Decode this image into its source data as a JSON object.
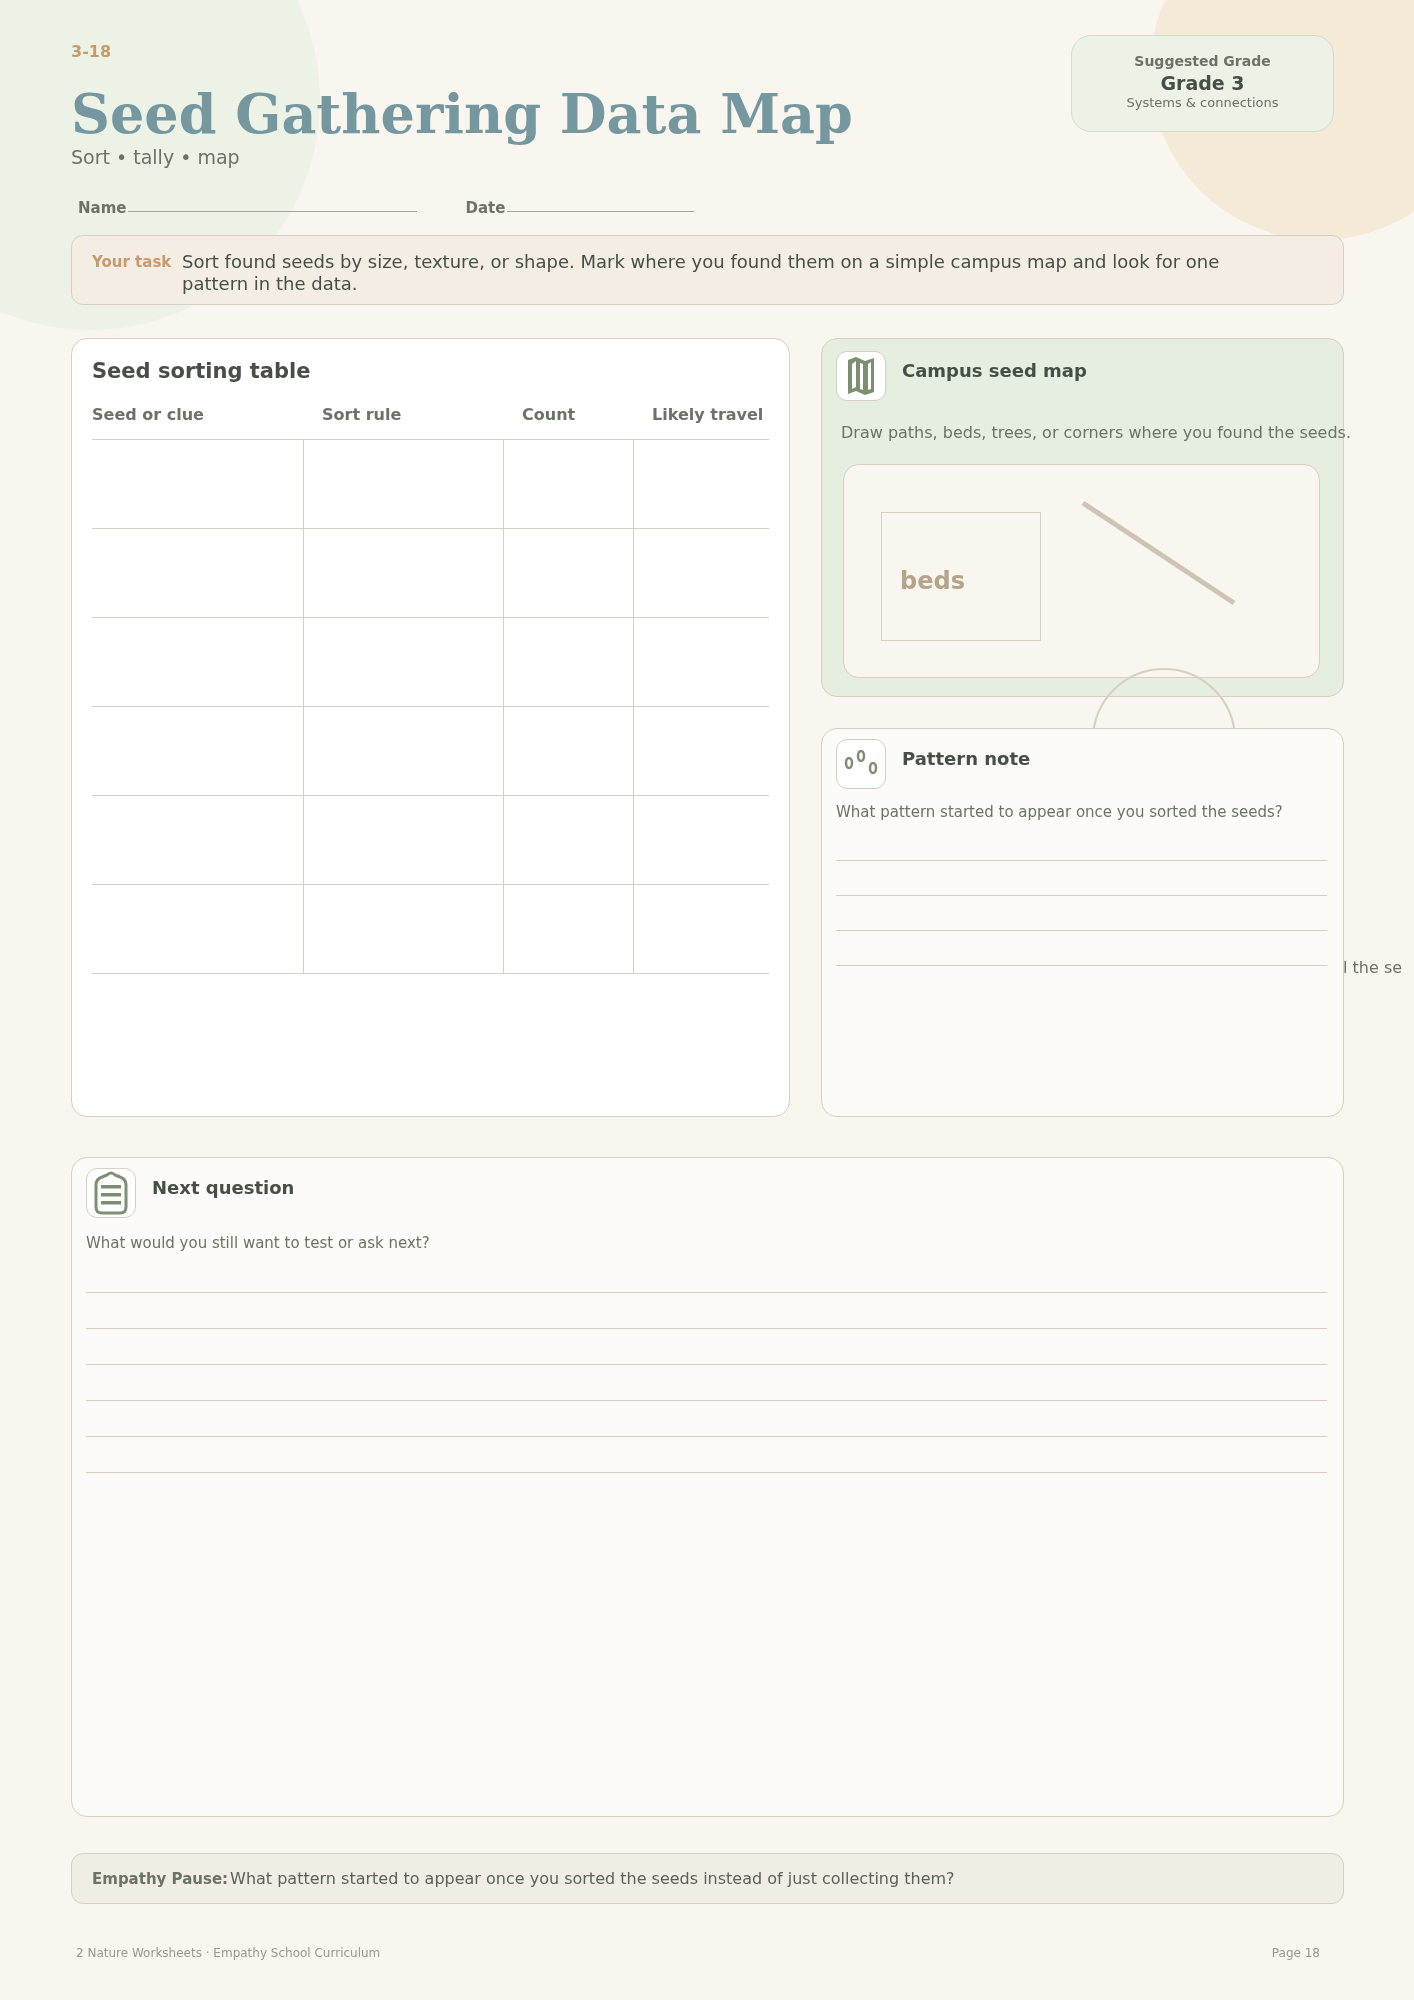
{
  "header": {
    "code": "3-18",
    "title": "Seed Gathering Data Map",
    "subtitle": "Sort • tally • map"
  },
  "grade_card": {
    "label": "Suggested Grade",
    "grade": "Grade 3",
    "strand": "Systems & connections"
  },
  "fields": [
    {
      "label": "Name"
    },
    {
      "label": "Date"
    }
  ],
  "task": {
    "label": "Your task",
    "text": "Sort found seeds by size, texture, or shape. Mark where you found them on a simple campus map and look for one pattern in the data."
  },
  "sorting_table": {
    "title": "Seed sorting table",
    "columns": [
      "Seed or clue",
      "Sort rule",
      "Count",
      "Likely travel"
    ]
  },
  "map_card": {
    "title": "Campus seed map",
    "caption": "Draw paths, beds, trees, or corners where you found the seeds.",
    "map_label": "beds"
  },
  "overflow_fragment": "l the se",
  "pattern_note": {
    "title": "Pattern note",
    "prompt": "What pattern started to appear once you sorted the seeds?"
  },
  "next_question": {
    "title": "Next question",
    "prompt": "What would you still want to test or ask next?"
  },
  "empathy_pause": {
    "label": "Empathy Pause:",
    "text": "What pattern started to appear once you sorted the seeds instead of just collecting them?"
  },
  "footer": {
    "left": "2 Nature Worksheets · Empathy School Curriculum",
    "right": "Page 18"
  }
}
